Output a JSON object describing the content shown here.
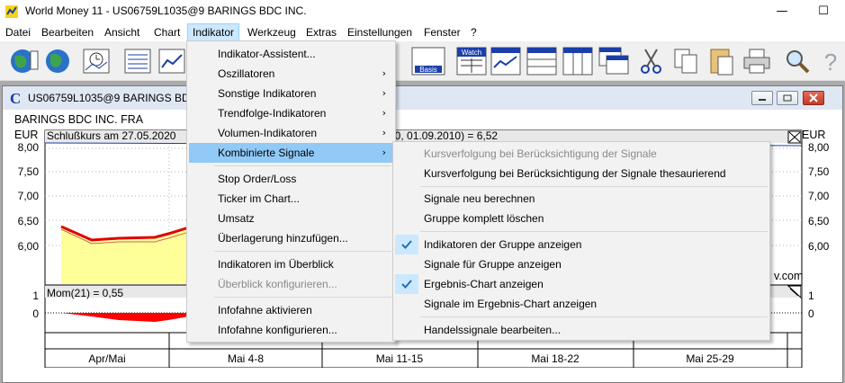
{
  "window": {
    "title": "World Money 11 - US06759L1035@9 BARINGS BDC INC.",
    "minimize_glyph": "—",
    "maximize_glyph": "☐"
  },
  "menubar": [
    "Datei",
    "Bearbeiten",
    "Ansicht",
    "Chart",
    "Indikator",
    "Werkzeug",
    "Extras",
    "Einstellungen",
    "Fenster",
    "?"
  ],
  "toolbar": {
    "watch_label": "Watch",
    "basis_label": "Basis"
  },
  "child_window": {
    "icon_letter": "C",
    "title": "US06759L1035@9 BARINGS BDC IN"
  },
  "chart": {
    "company": "BARINGS BDC INC. FRA",
    "currency": "EUR",
    "price_legend": "Schlußkurs am 27.05.2020",
    "price_legend_rest": "00, 01.09.2010) = 6,52",
    "momentum_legend": "Mom(21) = 0,55",
    "watermark": "v.com",
    "y_ticks_left": [
      "8,00",
      "7,50",
      "7,00",
      "6,50",
      "6,00"
    ],
    "y_ticks_right": [
      "8,00",
      "7,50",
      "7,00",
      "6,50",
      "6,00"
    ],
    "mom_ticks_left": [
      "1",
      "0"
    ],
    "mom_ticks_right": [
      "1",
      "0"
    ],
    "x_labels": [
      "Apr/Mai",
      "Mai 4-8",
      "Mai 11-15",
      "Mai 18-22",
      "Mai 25-29"
    ]
  },
  "dropdown": {
    "items": [
      {
        "label": "Indikator-Assistent...",
        "disabled": false,
        "submenu": false
      },
      {
        "label": "Oszillatoren",
        "disabled": false,
        "submenu": true
      },
      {
        "label": "Sonstige Indikatoren",
        "disabled": false,
        "submenu": true
      },
      {
        "label": "Trendfolge-Indikatoren",
        "disabled": false,
        "submenu": true
      },
      {
        "label": "Volumen-Indikatoren",
        "disabled": false,
        "submenu": true
      },
      {
        "label": "Kombinierte Signale",
        "disabled": false,
        "submenu": true
      },
      {
        "label": "Stop Order/Loss",
        "disabled": false,
        "submenu": false
      },
      {
        "label": "Ticker im Chart...",
        "disabled": false,
        "submenu": false
      },
      {
        "label": "Umsatz",
        "disabled": false,
        "submenu": false
      },
      {
        "label": "Überlagerung hinzufügen...",
        "disabled": false,
        "submenu": false
      },
      {
        "label": "Indikatoren im Überblick",
        "disabled": false,
        "submenu": false
      },
      {
        "label": "Überblick konfigurieren...",
        "disabled": true,
        "submenu": false
      },
      {
        "label": "Infofahne aktivieren",
        "disabled": false,
        "submenu": false
      },
      {
        "label": "Infofahne konfigurieren...",
        "disabled": false,
        "submenu": false
      }
    ],
    "submenu_arrow": "›"
  },
  "submenu": {
    "items": [
      {
        "label": "Kursverfolgung bei Berücksichtigung der Signale",
        "disabled": true,
        "checked": false
      },
      {
        "label": "Kursverfolgung bei Berücksichtigung der Signale thesaurierend",
        "disabled": false,
        "checked": false
      },
      {
        "label": "Signale neu berechnen",
        "disabled": false,
        "checked": false
      },
      {
        "label": "Gruppe komplett löschen",
        "disabled": false,
        "checked": false
      },
      {
        "label": "Indikatoren der Gruppe anzeigen",
        "disabled": false,
        "checked": true
      },
      {
        "label": "Signale für Gruppe anzeigen",
        "disabled": false,
        "checked": false
      },
      {
        "label": "Ergebnis-Chart anzeigen",
        "disabled": false,
        "checked": true
      },
      {
        "label": "Signale im Ergebnis-Chart anzeigen",
        "disabled": false,
        "checked": false
      },
      {
        "label": "Handelssignale bearbeiten...",
        "disabled": false,
        "checked": false
      }
    ]
  },
  "colors": {
    "highlight": "#91c9f7",
    "check_bg": "#cce8ff",
    "check": "#1f6fbf",
    "price_line": "#e00000",
    "price_fill": "#ffff99",
    "momentum": "#ff0000"
  }
}
